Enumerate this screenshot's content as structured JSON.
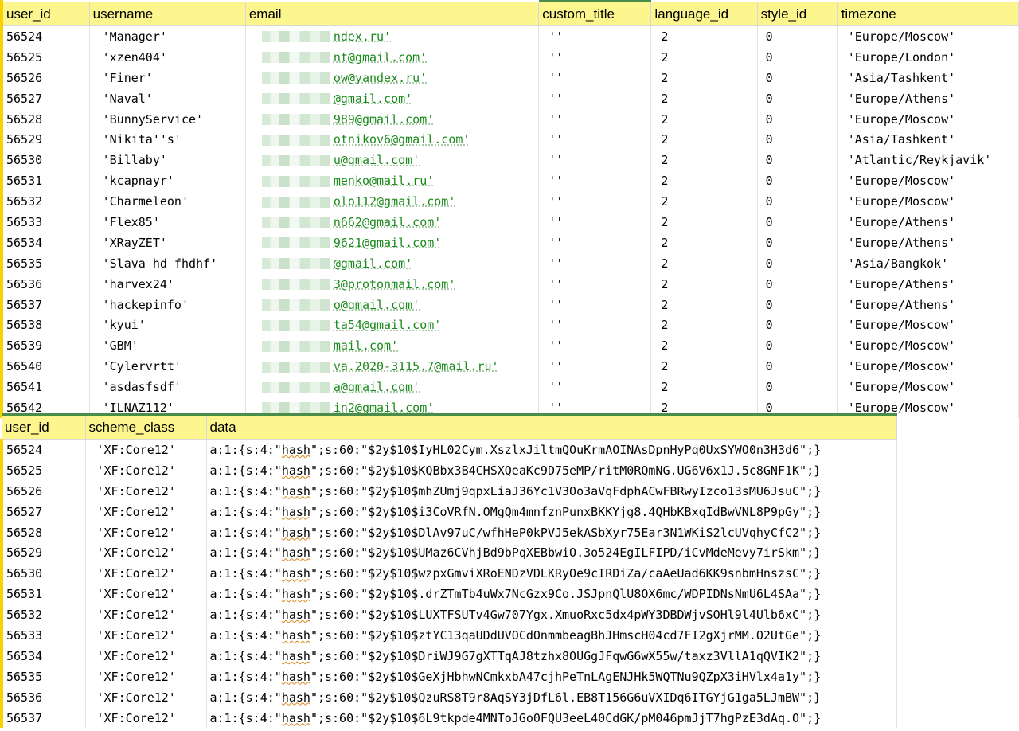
{
  "users": {
    "columns": [
      "user_id",
      "username",
      "email",
      "custom_title",
      "language_id",
      "style_id",
      "timezone"
    ],
    "rows": [
      {
        "user_id": "56524",
        "username": "'Manager'",
        "email": "ndex.ru'",
        "custom_title": "''",
        "language_id": "2",
        "style_id": "0",
        "timezone": "'Europe/Moscow'"
      },
      {
        "user_id": "56525",
        "username": "'xzen404'",
        "email": "nt@gmail.com'",
        "custom_title": "''",
        "language_id": "2",
        "style_id": "0",
        "timezone": "'Europe/London'"
      },
      {
        "user_id": "56526",
        "username": "'Finer'",
        "email": "ow@yandex.ru'",
        "custom_title": "''",
        "language_id": "2",
        "style_id": "0",
        "timezone": "'Asia/Tashkent'"
      },
      {
        "user_id": "56527",
        "username": "'Naval'",
        "email": "@gmail.com'",
        "custom_title": "''",
        "language_id": "2",
        "style_id": "0",
        "timezone": "'Europe/Athens'"
      },
      {
        "user_id": "56528",
        "username": "'BunnyService'",
        "email": "989@gmail.com'",
        "custom_title": "''",
        "language_id": "2",
        "style_id": "0",
        "timezone": "'Europe/Moscow'"
      },
      {
        "user_id": "56529",
        "username": "'Nikita''s'",
        "email": "otnikov6@gmail.com'",
        "custom_title": "''",
        "language_id": "2",
        "style_id": "0",
        "timezone": "'Asia/Tashkent'"
      },
      {
        "user_id": "56530",
        "username": "'Billaby'",
        "email": "u@gmail.com'",
        "custom_title": "''",
        "language_id": "2",
        "style_id": "0",
        "timezone": "'Atlantic/Reykjavik'"
      },
      {
        "user_id": "56531",
        "username": "'kcapnayr'",
        "email": "menko@mail.ru'",
        "custom_title": "''",
        "language_id": "2",
        "style_id": "0",
        "timezone": "'Europe/Moscow'"
      },
      {
        "user_id": "56532",
        "username": "'Charmeleon'",
        "email": "olo112@gmail.com'",
        "custom_title": "''",
        "language_id": "2",
        "style_id": "0",
        "timezone": "'Europe/Moscow'"
      },
      {
        "user_id": "56533",
        "username": "'Flex85'",
        "email": "n662@gmail.com'",
        "custom_title": "''",
        "language_id": "2",
        "style_id": "0",
        "timezone": "'Europe/Athens'"
      },
      {
        "user_id": "56534",
        "username": "'XRayZET'",
        "email": "9621@gmail.com'",
        "custom_title": "''",
        "language_id": "2",
        "style_id": "0",
        "timezone": "'Europe/Athens'"
      },
      {
        "user_id": "56535",
        "username": "'Slava hd fhdhf'",
        "email": "@gmail.com'",
        "custom_title": "''",
        "language_id": "2",
        "style_id": "0",
        "timezone": "'Asia/Bangkok'"
      },
      {
        "user_id": "56536",
        "username": "'harvex24'",
        "email": "3@protonmail.com'",
        "custom_title": "''",
        "language_id": "2",
        "style_id": "0",
        "timezone": "'Europe/Athens'"
      },
      {
        "user_id": "56537",
        "username": "'hackepinfo'",
        "email": "o@gmail.com'",
        "custom_title": "''",
        "language_id": "2",
        "style_id": "0",
        "timezone": "'Europe/Athens'"
      },
      {
        "user_id": "56538",
        "username": "'kyui'",
        "email": "ta54@gmail.com'",
        "custom_title": "''",
        "language_id": "2",
        "style_id": "0",
        "timezone": "'Europe/Moscow'"
      },
      {
        "user_id": "56539",
        "username": "'GBM'",
        "email": "mail.com'",
        "custom_title": "''",
        "language_id": "2",
        "style_id": "0",
        "timezone": "'Europe/Moscow'"
      },
      {
        "user_id": "56540",
        "username": "'Cylervrtt'",
        "email": "va.2020-3115.7@mail.ru'",
        "custom_title": "''",
        "language_id": "2",
        "style_id": "0",
        "timezone": "'Europe/Moscow'"
      },
      {
        "user_id": "56541",
        "username": "'asdasfsdf'",
        "email": "a@gmail.com'",
        "custom_title": "''",
        "language_id": "2",
        "style_id": "0",
        "timezone": "'Europe/Moscow'"
      },
      {
        "user_id": "56542",
        "username": "'ILNAZ112'",
        "email": "in2@gmail.com'",
        "custom_title": "''",
        "language_id": "2",
        "style_id": "0",
        "timezone": "'Europe/Moscow'"
      }
    ]
  },
  "auth": {
    "columns": [
      "user_id",
      "scheme_class",
      "data"
    ],
    "data_prefix": "a:1:{s:4:\"",
    "data_key": "hash",
    "data_mid": "\";s:60:\"",
    "data_suffix": "\";}",
    "rows": [
      {
        "user_id": "56524",
        "scheme_class": "'XF:Core12'",
        "hash": "$2y$10$IyHL02Cym.XszlxJiltmQOuKrmAOINAsDpnHyPq0UxSYWO0n3H3d6"
      },
      {
        "user_id": "56525",
        "scheme_class": "'XF:Core12'",
        "hash": "$2y$10$KQBbx3B4CHSXQeaKc9D75eMP/ritM0RQmNG.UG6V6x1J.5c8GNF1K"
      },
      {
        "user_id": "56526",
        "scheme_class": "'XF:Core12'",
        "hash": "$2y$10$mhZUmj9qpxLiaJ36Yc1V3Oo3aVqFdphACwFBRwyIzco13sMU6JsuC"
      },
      {
        "user_id": "56527",
        "scheme_class": "'XF:Core12'",
        "hash": "$2y$10$i3CoVRfN.OMgQm4mnfznPunxBKKYjg8.4QHbKBxqIdBwVNL8P9pGy"
      },
      {
        "user_id": "56528",
        "scheme_class": "'XF:Core12'",
        "hash": "$2y$10$DlAv97uC/wfhHeP0kPVJ5ekASbXyr75Ear3N1WKiS2lcUVqhyCfC2"
      },
      {
        "user_id": "56529",
        "scheme_class": "'XF:Core12'",
        "hash": "$2y$10$UMaz6CVhjBd9bPqXEBbwiO.3o524EgILFIPD/iCvMdeMevy7irSkm"
      },
      {
        "user_id": "56530",
        "scheme_class": "'XF:Core12'",
        "hash": "$2y$10$wzpxGmviXRoENDzVDLKRyOe9cIRDiZa/caAeUad6KK9snbmHnszsC"
      },
      {
        "user_id": "56531",
        "scheme_class": "'XF:Core12'",
        "hash": "$2y$10$.drZTmTb4uWx7NcGzx9Co.JSJpnQlU8OX6mc/WDPIDNsNmU6L4SAa"
      },
      {
        "user_id": "56532",
        "scheme_class": "'XF:Core12'",
        "hash": "$2y$10$LUXTFSUTv4Gw707Ygx.XmuoRxc5dx4pWY3DBDWjvSOHl9l4Ulb6xC"
      },
      {
        "user_id": "56533",
        "scheme_class": "'XF:Core12'",
        "hash": "$2y$10$ztYC13qaUDdUVOCdOnmmbeagBhJHmscH04cd7FI2gXjrMM.O2UtGe"
      },
      {
        "user_id": "56534",
        "scheme_class": "'XF:Core12'",
        "hash": "$2y$10$DriWJ9G7gXTTqAJ8tzhx8OUGgJFqwG6wX55w/taxz3VllA1qQVIK2"
      },
      {
        "user_id": "56535",
        "scheme_class": "'XF:Core12'",
        "hash": "$2y$10$GeXjHbhwNCmkxbA47cjhPeTnLAgENJHk5WQTNu9QZpX3iHVlx4a1y"
      },
      {
        "user_id": "56536",
        "scheme_class": "'XF:Core12'",
        "hash": "$2y$10$QzuRS8T9r8AqSY3jDfL6l.EB8T156G6uVXIDq6ITGYjG1ga5LJmBW"
      },
      {
        "user_id": "56537",
        "scheme_class": "'XF:Core12'",
        "hash": "$2y$10$6L9tkpde4MNToJGo0FQU3eeL40CdGK/pM046pmJjT7hgPzE3dAq.O"
      }
    ]
  }
}
